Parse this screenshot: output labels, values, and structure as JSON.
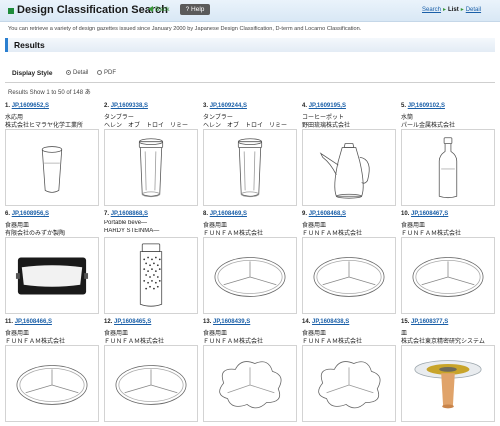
{
  "header": {
    "title": "Design Classification Search",
    "back_label": "Back",
    "help_label": "? Help",
    "steps": [
      "Search",
      "List",
      "Detail"
    ]
  },
  "intro": "You can retrieve a variety of design gazettes issued since January 2000 by Japanese Design Classification, D-term and Locarno Classification.",
  "results_heading": "Results",
  "display_style": {
    "label": "Display Style",
    "options": [
      "Detail",
      "PDF"
    ],
    "selected": "Detail"
  },
  "results_count": "Results Show 1 to 50 of 148 あ",
  "items": [
    {
      "index": "1.",
      "id": "JP,1609652,S",
      "name": "水応用",
      "owner": "株式会社ヒマラヤ化学工業所",
      "icon": "cup-icon"
    },
    {
      "index": "2.",
      "id": "JP,1609338,S",
      "name": "タンブラー",
      "owner": "ヘレン　オブ　トロイ　リミー",
      "icon": "tumbler-icon"
    },
    {
      "index": "3.",
      "id": "JP,1609244,S",
      "name": "タンブラー",
      "owner": "ヘレン　オブ　トロイ　リミー",
      "icon": "tumbler-icon"
    },
    {
      "index": "4.",
      "id": "JP,1609195,S",
      "name": "コーヒーポット",
      "owner": "野田琉璃株式会社",
      "icon": "coffee-pot-icon"
    },
    {
      "index": "5.",
      "id": "JP,1609102,S",
      "name": "水筒",
      "owner": "パール金属株式会社",
      "icon": "bottle-icon"
    },
    {
      "index": "6.",
      "id": "JP,1608956,S",
      "name": "食器用皿",
      "owner": "有限会社のみずか製陶",
      "icon": "tray-icon"
    },
    {
      "index": "7.",
      "id": "JP,1608868,S",
      "name": "Portable beve—",
      "owner": "HARDY STEINMA—",
      "icon": "flask-icon"
    },
    {
      "index": "8.",
      "id": "JP,1608469,S",
      "name": "食器用皿",
      "owner": "ＦＵＮＦＡＭ株式会社",
      "icon": "plate-icon"
    },
    {
      "index": "9.",
      "id": "JP,1608468,S",
      "name": "食器用皿",
      "owner": "ＦＵＮＦＡＭ株式会社",
      "icon": "plate-icon"
    },
    {
      "index": "10.",
      "id": "JP,1608467,S",
      "name": "食器用皿",
      "owner": "ＦＵＮＦＡＭ株式会社",
      "icon": "plate-icon"
    },
    {
      "index": "11.",
      "id": "JP,1608466,S",
      "name": "食器用皿",
      "owner": "ＦＵＮＦＡＭ株式会社",
      "icon": "plate-icon"
    },
    {
      "index": "12.",
      "id": "JP,1608465,S",
      "name": "食器用皿",
      "owner": "ＦＵＮＦＡＭ株式会社",
      "icon": "plate-icon"
    },
    {
      "index": "13.",
      "id": "JP,1608439,S",
      "name": "食器用皿",
      "owner": "ＦＵＮＦＡＭ株式会社",
      "icon": "flower-plate-icon"
    },
    {
      "index": "14.",
      "id": "JP,1608438,S",
      "name": "食器用皿",
      "owner": "ＦＵＮＦＡＭ株式会社",
      "icon": "flower-plate-icon"
    },
    {
      "index": "15.",
      "id": "JP,1608377,S",
      "name": "皿",
      "owner": "株式会社東京精密研究システム",
      "icon": "stand-plate-icon"
    }
  ],
  "colors": {
    "accent": "#2a7fd0",
    "link": "#1a5fa8",
    "header_bg": "#d9e8f5",
    "help_bg": "#5a5a5a"
  }
}
